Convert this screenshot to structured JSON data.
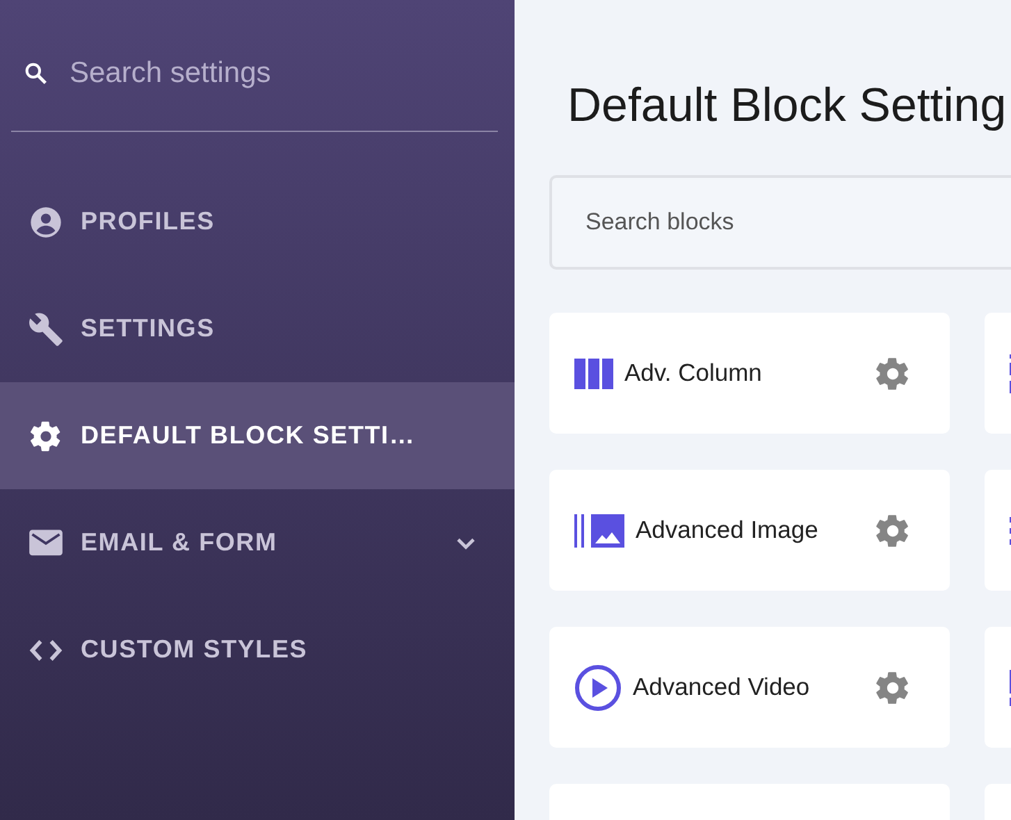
{
  "sidebar": {
    "search": {
      "placeholder": "Search settings"
    },
    "items": [
      {
        "label": "PROFILES",
        "kind": "profile",
        "selected": false
      },
      {
        "label": "SETTINGS",
        "kind": "wrench",
        "selected": false
      },
      {
        "label": "DEFAULT BLOCK SETTI…",
        "kind": "gear",
        "selected": true
      },
      {
        "label": "EMAIL & FORM",
        "kind": "mail",
        "selected": false,
        "expanded": false
      },
      {
        "label": "CUSTOM STYLES",
        "kind": "code",
        "selected": false
      }
    ]
  },
  "main": {
    "title": "Default Block Setting",
    "search": {
      "placeholder": "Search blocks"
    },
    "blocks": [
      {
        "label": "Adv. Column",
        "kind": "columns"
      },
      {
        "kind": "rows"
      },
      {
        "label": "Advanced Image",
        "kind": "image"
      },
      {
        "kind": "dots"
      },
      {
        "label": "Advanced Video",
        "kind": "video"
      },
      {
        "kind": "bar"
      },
      {
        "kind": "blank"
      },
      {
        "kind": "blank"
      }
    ]
  }
}
